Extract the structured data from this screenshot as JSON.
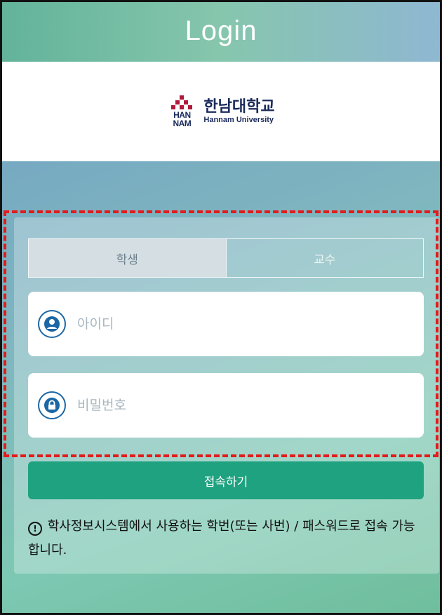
{
  "header": {
    "title": "Login"
  },
  "logo": {
    "mark_top": "HAN",
    "mark_bottom": "NAM",
    "name_ko": "한남대학교",
    "name_en": "Hannam University"
  },
  "tabs": [
    {
      "label": "학생",
      "active": true
    },
    {
      "label": "교수",
      "active": false
    }
  ],
  "form": {
    "id_placeholder": "아이디",
    "id_value": "",
    "password_placeholder": "비밀번호",
    "password_value": "",
    "submit_label": "접속하기"
  },
  "notice": {
    "icon": "!",
    "text": "학사정보시스템에서 사용하는 학번(또는 사번) / 패스워드로 접속 가능합니다."
  },
  "colors": {
    "accent": "#1ea27f",
    "icon_blue": "#1b67a6",
    "highlight": "#e21b1b"
  }
}
